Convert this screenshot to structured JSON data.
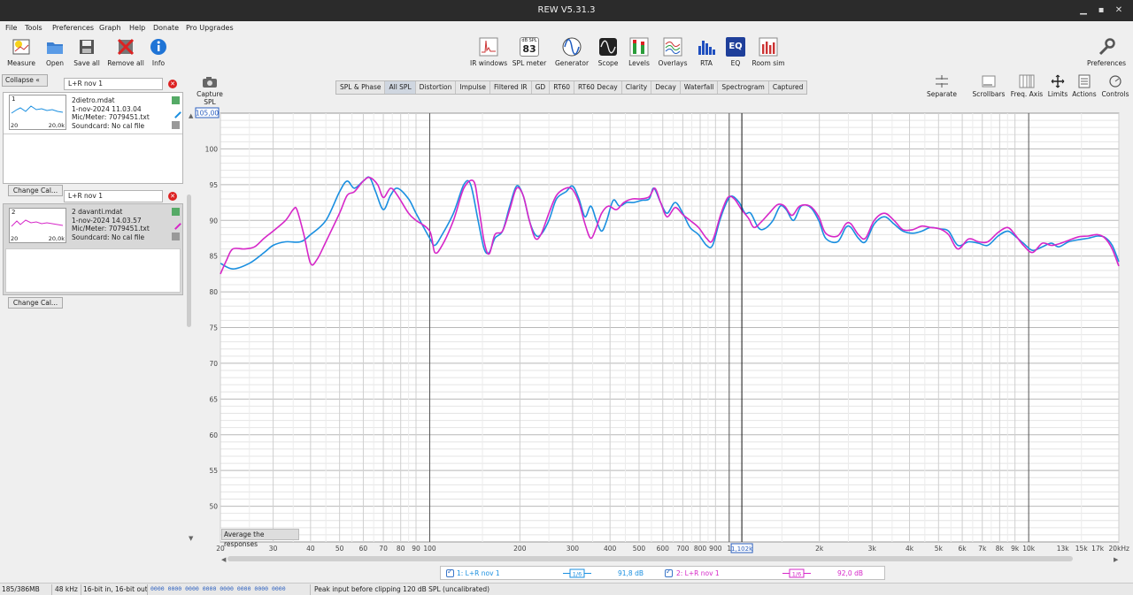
{
  "window": {
    "title": "REW V5.31.3"
  },
  "menu": [
    "File",
    "Tools",
    "Preferences",
    "Graph",
    "Help",
    "Donate",
    "Pro Upgrades"
  ],
  "toolbar": {
    "left": [
      {
        "label": "Measure",
        "icon": "measure-icon"
      },
      {
        "label": "Open",
        "icon": "open-folder-icon"
      },
      {
        "label": "Save all",
        "icon": "save-all-icon"
      },
      {
        "label": "Remove all",
        "icon": "remove-all-icon"
      },
      {
        "label": "Info",
        "icon": "info-icon"
      }
    ],
    "center": [
      {
        "label": "IR windows",
        "icon": "ir-windows-icon"
      },
      {
        "label": "SPL meter",
        "icon": "spl-meter-icon",
        "badge_top": "dB SPL",
        "badge_value": "83"
      },
      {
        "label": "Generator",
        "icon": "generator-icon"
      },
      {
        "label": "Scope",
        "icon": "scope-icon"
      },
      {
        "label": "Levels",
        "icon": "levels-icon"
      },
      {
        "label": "Overlays",
        "icon": "overlays-icon"
      },
      {
        "label": "RTA",
        "icon": "rta-icon"
      },
      {
        "label": "EQ",
        "icon": "eq-icon"
      },
      {
        "label": "Room sim",
        "icon": "room-sim-icon"
      }
    ],
    "preferences": {
      "label": "Preferences",
      "icon": "wrench-icon"
    }
  },
  "left_panel": {
    "collapse_label": "Collapse",
    "measurements": [
      {
        "index": "1",
        "name": "L+R nov 1",
        "file": "2dietro.mdat",
        "date": "1-nov-2024 11.03.04",
        "mic": "Mic/Meter: 7079451.txt",
        "soundcard": "Soundcard: No cal file",
        "thumb_min": "20",
        "thumb_max": "20,0k",
        "color": "#1a8fe0",
        "change_cal": "Change Cal..."
      },
      {
        "index": "2",
        "name": "L+R nov 1",
        "file": "2 davanti.mdat",
        "date": "1-nov-2024 14.03.57",
        "mic": "Mic/Meter: 7079451.txt",
        "soundcard": "Soundcard: No cal file",
        "thumb_min": "20",
        "thumb_max": "20,0k",
        "color": "#d627c8",
        "change_cal": "Change Cal..."
      }
    ]
  },
  "capture": {
    "label1": "Capture",
    "label2": "SPL"
  },
  "graph_tabs": [
    {
      "label": "SPL & Phase",
      "active": false
    },
    {
      "label": "All SPL",
      "active": true
    },
    {
      "label": "Distortion",
      "active": false
    },
    {
      "label": "Impulse",
      "active": false
    },
    {
      "label": "Filtered IR",
      "active": false
    },
    {
      "label": "GD",
      "active": false
    },
    {
      "label": "RT60",
      "active": false
    },
    {
      "label": "RT60 Decay",
      "active": false
    },
    {
      "label": "Clarity",
      "active": false
    },
    {
      "label": "Decay",
      "active": false
    },
    {
      "label": "Waterfall",
      "active": false
    },
    {
      "label": "Spectrogram",
      "active": false
    },
    {
      "label": "Captured",
      "active": false
    }
  ],
  "right_tools": [
    {
      "label": "Separate",
      "icon": "separate-icon"
    },
    {
      "label": "Scrollbars",
      "icon": "scrollbars-icon"
    },
    {
      "label": "Freq. Axis",
      "icon": "freq-axis-icon"
    },
    {
      "label": "Limits",
      "icon": "limits-icon"
    },
    {
      "label": "Actions",
      "icon": "actions-icon"
    },
    {
      "label": "Controls",
      "icon": "controls-icon"
    }
  ],
  "graph": {
    "y_top_box": "105,00",
    "cursor_label": "1,102k",
    "average_button": "Average the responses"
  },
  "chart_data": {
    "type": "line",
    "xscale": "log",
    "xlim": [
      20,
      20000
    ],
    "ylim": [
      45,
      105
    ],
    "yticks": [
      50,
      55,
      60,
      65,
      70,
      75,
      80,
      85,
      90,
      95,
      100
    ],
    "ytick_labels": [
      "50",
      "55",
      "60",
      "65",
      "70",
      "75",
      "80",
      "85",
      "90",
      "95",
      "100"
    ],
    "xtick_labels": [
      {
        "x": 20,
        "label": "20"
      },
      {
        "x": 30,
        "label": "30"
      },
      {
        "x": 40,
        "label": "40"
      },
      {
        "x": 50,
        "label": "50"
      },
      {
        "x": 60,
        "label": "60"
      },
      {
        "x": 70,
        "label": "70"
      },
      {
        "x": 80,
        "label": "80"
      },
      {
        "x": 90,
        "label": "90"
      },
      {
        "x": 100,
        "label": "100"
      },
      {
        "x": 200,
        "label": "200"
      },
      {
        "x": 300,
        "label": "300"
      },
      {
        "x": 400,
        "label": "400"
      },
      {
        "x": 500,
        "label": "500"
      },
      {
        "x": 600,
        "label": "600"
      },
      {
        "x": 700,
        "label": "700"
      },
      {
        "x": 800,
        "label": "800"
      },
      {
        "x": 900,
        "label": "900"
      },
      {
        "x": 1000,
        "label": "1"
      },
      {
        "x": 2000,
        "label": "2k"
      },
      {
        "x": 3000,
        "label": "3k"
      },
      {
        "x": 4000,
        "label": "4k"
      },
      {
        "x": 5000,
        "label": "5k"
      },
      {
        "x": 6000,
        "label": "6k"
      },
      {
        "x": 7000,
        "label": "7k"
      },
      {
        "x": 8000,
        "label": "8k"
      },
      {
        "x": 9000,
        "label": "9k"
      },
      {
        "x": 10000,
        "label": "10k"
      },
      {
        "x": 13000,
        "label": "13k"
      },
      {
        "x": 15000,
        "label": "15k"
      },
      {
        "x": 17000,
        "label": "17k"
      },
      {
        "x": 20000,
        "label": "20kHz"
      }
    ],
    "cursor_x": 1102,
    "series": [
      {
        "name": "1: L+R nov 1",
        "color": "#1a8fe0",
        "points": [
          [
            20,
            84
          ],
          [
            22,
            83.2
          ],
          [
            25,
            84
          ],
          [
            28,
            85.5
          ],
          [
            30,
            86.5
          ],
          [
            33,
            87
          ],
          [
            37,
            87
          ],
          [
            40,
            88
          ],
          [
            45,
            90
          ],
          [
            50,
            94
          ],
          [
            53,
            95.5
          ],
          [
            56,
            94.5
          ],
          [
            60,
            95.5
          ],
          [
            63,
            96
          ],
          [
            66,
            94
          ],
          [
            70,
            91.5
          ],
          [
            74,
            93.5
          ],
          [
            78,
            94.5
          ],
          [
            85,
            93
          ],
          [
            90,
            91
          ],
          [
            100,
            87.5
          ],
          [
            104,
            86.5
          ],
          [
            110,
            88
          ],
          [
            120,
            91
          ],
          [
            130,
            95
          ],
          [
            137,
            95
          ],
          [
            145,
            90
          ],
          [
            152,
            86
          ],
          [
            158,
            85.5
          ],
          [
            165,
            87.5
          ],
          [
            175,
            88.5
          ],
          [
            185,
            92
          ],
          [
            195,
            94.8
          ],
          [
            205,
            93.5
          ],
          [
            215,
            90
          ],
          [
            225,
            88
          ],
          [
            235,
            88
          ],
          [
            250,
            90
          ],
          [
            265,
            93
          ],
          [
            285,
            94
          ],
          [
            300,
            94.8
          ],
          [
            315,
            93
          ],
          [
            330,
            90.5
          ],
          [
            345,
            92
          ],
          [
            360,
            90
          ],
          [
            375,
            88.5
          ],
          [
            390,
            90
          ],
          [
            410,
            92.8
          ],
          [
            430,
            92
          ],
          [
            455,
            92.5
          ],
          [
            480,
            92.5
          ],
          [
            510,
            92.8
          ],
          [
            540,
            93
          ],
          [
            560,
            94.5
          ],
          [
            590,
            92.5
          ],
          [
            620,
            91
          ],
          [
            660,
            92.5
          ],
          [
            700,
            91
          ],
          [
            740,
            89
          ],
          [
            790,
            88
          ],
          [
            840,
            86.5
          ],
          [
            880,
            86.5
          ],
          [
            930,
            90
          ],
          [
            980,
            92.5
          ],
          [
            1020,
            93.4
          ],
          [
            1080,
            92.5
          ],
          [
            1130,
            91
          ],
          [
            1180,
            91
          ],
          [
            1250,
            89
          ],
          [
            1310,
            88.8
          ],
          [
            1400,
            90
          ],
          [
            1480,
            92
          ],
          [
            1550,
            91.5
          ],
          [
            1640,
            90
          ],
          [
            1740,
            92
          ],
          [
            1870,
            91.8
          ],
          [
            1990,
            90
          ],
          [
            2100,
            87.5
          ],
          [
            2300,
            87
          ],
          [
            2450,
            89
          ],
          [
            2550,
            89
          ],
          [
            2700,
            87.5
          ],
          [
            2850,
            87
          ],
          [
            3050,
            89.5
          ],
          [
            3300,
            90.5
          ],
          [
            3550,
            89.5
          ],
          [
            3800,
            88.5
          ],
          [
            4100,
            88.2
          ],
          [
            4400,
            88.5
          ],
          [
            4700,
            89
          ],
          [
            5050,
            88.8
          ],
          [
            5400,
            88.5
          ],
          [
            5800,
            86.5
          ],
          [
            6300,
            87
          ],
          [
            6800,
            86.8
          ],
          [
            7300,
            86.5
          ],
          [
            7900,
            87.8
          ],
          [
            8500,
            88.5
          ],
          [
            9000,
            87.8
          ],
          [
            9600,
            86.8
          ],
          [
            10300,
            85.8
          ],
          [
            11100,
            86.3
          ],
          [
            11900,
            86.8
          ],
          [
            12600,
            86.3
          ],
          [
            13600,
            87
          ],
          [
            14700,
            87.3
          ],
          [
            15800,
            87.5
          ],
          [
            17000,
            87.8
          ],
          [
            18000,
            87.6
          ],
          [
            19000,
            86.5
          ],
          [
            20000,
            84.2
          ]
        ]
      },
      {
        "name": "2: L+R nov 1",
        "color": "#d627c8",
        "points": [
          [
            20,
            82.5
          ],
          [
            21,
            84.5
          ],
          [
            22,
            86
          ],
          [
            24,
            86
          ],
          [
            26,
            86.3
          ],
          [
            28,
            87.5
          ],
          [
            30,
            88.5
          ],
          [
            33,
            90
          ],
          [
            35,
            91.5
          ],
          [
            36,
            91.5
          ],
          [
            38,
            88
          ],
          [
            40,
            84
          ],
          [
            42,
            84.5
          ],
          [
            45,
            87
          ],
          [
            50,
            91
          ],
          [
            53,
            93.5
          ],
          [
            56,
            94
          ],
          [
            60,
            95.5
          ],
          [
            63,
            96
          ],
          [
            67,
            95
          ],
          [
            70,
            93.2
          ],
          [
            74,
            94.5
          ],
          [
            78,
            93.5
          ],
          [
            85,
            91
          ],
          [
            90,
            90
          ],
          [
            100,
            88.5
          ],
          [
            104,
            85.5
          ],
          [
            110,
            86.5
          ],
          [
            120,
            90
          ],
          [
            130,
            94.5
          ],
          [
            140,
            95.5
          ],
          [
            145,
            92.5
          ],
          [
            152,
            87
          ],
          [
            158,
            85.3
          ],
          [
            165,
            88
          ],
          [
            175,
            88.5
          ],
          [
            185,
            91.5
          ],
          [
            195,
            94.5
          ],
          [
            205,
            93.5
          ],
          [
            215,
            90
          ],
          [
            225,
            87.5
          ],
          [
            235,
            88
          ],
          [
            250,
            91
          ],
          [
            265,
            93.5
          ],
          [
            285,
            94.5
          ],
          [
            300,
            94.3
          ],
          [
            315,
            92.5
          ],
          [
            330,
            89.5
          ],
          [
            345,
            87.5
          ],
          [
            360,
            89
          ],
          [
            375,
            91
          ],
          [
            395,
            92
          ],
          [
            420,
            91.5
          ],
          [
            445,
            92.5
          ],
          [
            475,
            93
          ],
          [
            505,
            93
          ],
          [
            540,
            93.3
          ],
          [
            565,
            94.5
          ],
          [
            590,
            92.5
          ],
          [
            620,
            90.5
          ],
          [
            660,
            91.8
          ],
          [
            700,
            90.8
          ],
          [
            740,
            90
          ],
          [
            790,
            89
          ],
          [
            840,
            87.5
          ],
          [
            880,
            87.2
          ],
          [
            940,
            91
          ],
          [
            990,
            93.2
          ],
          [
            1040,
            93
          ],
          [
            1100,
            91.5
          ],
          [
            1160,
            90.3
          ],
          [
            1210,
            89
          ],
          [
            1280,
            89.8
          ],
          [
            1360,
            91
          ],
          [
            1450,
            92.2
          ],
          [
            1530,
            92
          ],
          [
            1620,
            90.7
          ],
          [
            1720,
            92
          ],
          [
            1860,
            92
          ],
          [
            1990,
            90.5
          ],
          [
            2100,
            88.2
          ],
          [
            2300,
            87.8
          ],
          [
            2450,
            89.5
          ],
          [
            2550,
            89.5
          ],
          [
            2700,
            88
          ],
          [
            2850,
            87.5
          ],
          [
            3050,
            90
          ],
          [
            3300,
            91
          ],
          [
            3550,
            90
          ],
          [
            3800,
            88.7
          ],
          [
            4100,
            88.7
          ],
          [
            4400,
            89.2
          ],
          [
            4700,
            89
          ],
          [
            5050,
            88.8
          ],
          [
            5400,
            88
          ],
          [
            5800,
            86
          ],
          [
            6300,
            87.4
          ],
          [
            6800,
            87
          ],
          [
            7300,
            87
          ],
          [
            7900,
            88.3
          ],
          [
            8500,
            89
          ],
          [
            9000,
            88
          ],
          [
            9600,
            86.5
          ],
          [
            10300,
            85.5
          ],
          [
            11100,
            86.8
          ],
          [
            11900,
            86.5
          ],
          [
            12600,
            86.7
          ],
          [
            13600,
            87.2
          ],
          [
            14700,
            87.7
          ],
          [
            15800,
            87.8
          ],
          [
            17000,
            88
          ],
          [
            18000,
            87.5
          ],
          [
            19000,
            86
          ],
          [
            20000,
            83.6
          ]
        ]
      }
    ]
  },
  "legend": [
    {
      "label": "1: L+R nov 1",
      "smoothing": "1/6",
      "value": "91,8 dB",
      "color": "#1a8fe0"
    },
    {
      "label": "2: L+R nov 1",
      "smoothing": "1/6",
      "value": "92,0 dB",
      "color": "#d627c8"
    }
  ],
  "status": {
    "memory": "185/386MB",
    "rate": "48 kHz",
    "bits": "16-bit in, 16-bit out",
    "meters": "0000 0000  0000 0000  0000 0000  0000 0000",
    "message": "Peak input before clipping 120 dB SPL (uncalibrated)"
  }
}
